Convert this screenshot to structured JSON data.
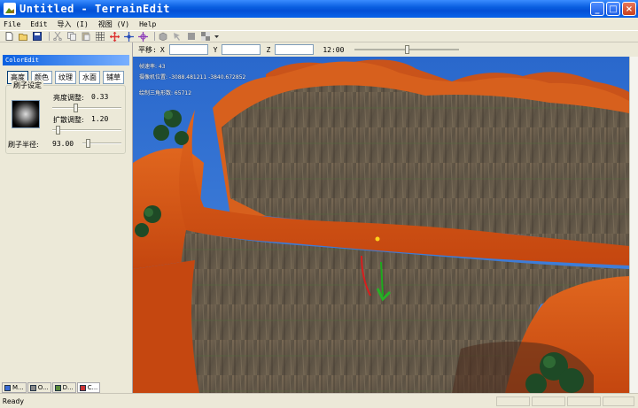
{
  "window": {
    "title": "Untitled - TerrainEdit",
    "minimize": "_",
    "maximize": "□",
    "close": "×"
  },
  "menu": [
    "File",
    "Edit",
    "导入 (I)",
    "视图 (V)",
    "Help"
  ],
  "toolbar": {
    "buttons": [
      "new",
      "open",
      "save",
      "cut",
      "copy",
      "paste",
      "grid",
      "move",
      "crosshair",
      "target",
      "cube",
      "arrow",
      "box",
      "checker"
    ]
  },
  "left_panel": {
    "caption": "ColorEdit",
    "tabs": [
      "高度",
      "颜色",
      "纹理",
      "水面",
      "铺草"
    ],
    "active_tab": "高度",
    "brush_group": {
      "title": "刷子设定",
      "brightness_label": "亮度调整:",
      "brightness_value": "0.33",
      "brightness_level": 0.33,
      "diffuse_label": "扩散调整:",
      "diffuse_value": "1.20",
      "diffuse_level": 0.06,
      "radius_label": "刷子半径:",
      "radius_value": "93.00",
      "radius_level": 0.1
    },
    "bottom_tabs": [
      "M...",
      "O...",
      "D...",
      "C..."
    ]
  },
  "coordbar": {
    "move_label": "平移:",
    "x_label": "X",
    "y_label": "Y",
    "z_label": "Z",
    "time": "12:00",
    "time_level": 0.5
  },
  "hud": {
    "line1": "帧速率: 43",
    "line2": "摄像机位置: -3088.481211 -3840.672852",
    "line3": "绘制三角形数: 65712"
  },
  "status": {
    "text": "Ready"
  },
  "colors": {
    "titlebar": "#0a5fe0",
    "sky": "#2f6fd0",
    "ground": "#d2541a",
    "rock": "#6a5d4c"
  }
}
